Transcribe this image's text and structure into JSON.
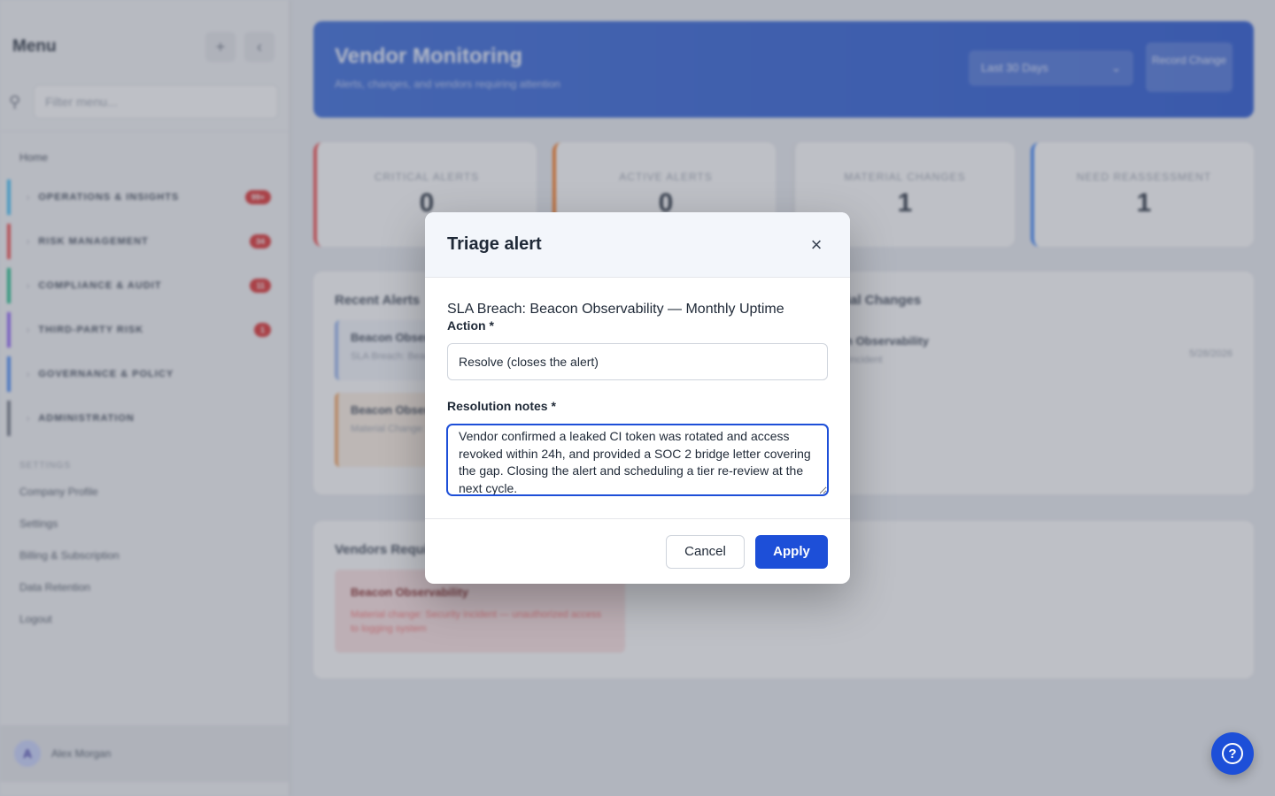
{
  "sidebar": {
    "title": "Menu",
    "add_icon": "plus-icon",
    "collapse_icon": "chevron-left-icon",
    "search_placeholder": "Filter menu...",
    "home": "Home",
    "groups": [
      {
        "label": "OPERATIONS & INSIGHTS",
        "badge": "99+",
        "color": "#38bdf8"
      },
      {
        "label": "RISK MANAGEMENT",
        "badge": "34",
        "color": "#ef4444"
      },
      {
        "label": "COMPLIANCE & AUDIT",
        "badge": "11",
        "color": "#10b981"
      },
      {
        "label": "THIRD-PARTY RISK",
        "badge": "1",
        "color": "#8b5cf6"
      },
      {
        "label": "GOVERNANCE & POLICY",
        "badge": "",
        "color": "#3b82f6"
      },
      {
        "label": "ADMINISTRATION",
        "badge": "",
        "color": "#6b7280"
      }
    ],
    "settings_section": "SETTINGS",
    "links": [
      "Company Profile",
      "Settings",
      "Billing & Subscription",
      "Data Retention",
      "Logout"
    ],
    "user": {
      "initial": "A",
      "name": "Alex Morgan"
    }
  },
  "header": {
    "title": "Vendor Monitoring",
    "subtitle": "Alerts, changes, and vendors requiring attention",
    "range_select": "Last 30 Days",
    "record_button": "Record Change"
  },
  "stats": [
    {
      "label": "CRITICAL ALERTS",
      "value": "0",
      "color": "#ef4444"
    },
    {
      "label": "ACTIVE ALERTS",
      "value": "0",
      "color": "#f97316"
    },
    {
      "label": "MATERIAL CHANGES",
      "value": "1",
      "color": "#e5e7eb"
    },
    {
      "label": "NEED REASSESSMENT",
      "value": "1",
      "color": "#3b82f6"
    }
  ],
  "recent_alerts": {
    "title": "Recent Alerts",
    "items": [
      {
        "title": "Beacon Observability",
        "sub": "SLA Breach: Beacon Observability"
      },
      {
        "title": "Beacon Observability",
        "sub": "Material Change: Security incident — unauthorized access to logging system"
      }
    ]
  },
  "material_changes": {
    "title": "Material Changes",
    "items": [
      {
        "title": "Beacon Observability",
        "sub": "Security incident",
        "date": "5/28/2026"
      }
    ]
  },
  "vendors_reassessment": {
    "title": "Vendors Requiring Reassessment",
    "items": [
      {
        "title": "Beacon Observability",
        "sub": "Material change: Security incident — unauthorized access to logging system"
      }
    ]
  },
  "modal": {
    "title": "Triage alert",
    "close_icon": "close-icon",
    "context": "SLA Breach: Beacon Observability — Monthly Uptime",
    "action_label": "Action *",
    "action_value": "Resolve (closes the alert)",
    "notes_label": "Resolution notes *",
    "notes_value": "Vendor confirmed a leaked CI token was rotated and access revoked within 24h, and provided a SOC 2 bridge letter covering the gap. Closing the alert and scheduling a tier re-review at the next cycle.",
    "cancel_label": "Cancel",
    "apply_label": "Apply"
  },
  "help": {
    "icon": "help-circle-icon",
    "glyph": "?"
  },
  "colors": {
    "accent": "#1d4fd8",
    "danger": "#dc2626"
  }
}
